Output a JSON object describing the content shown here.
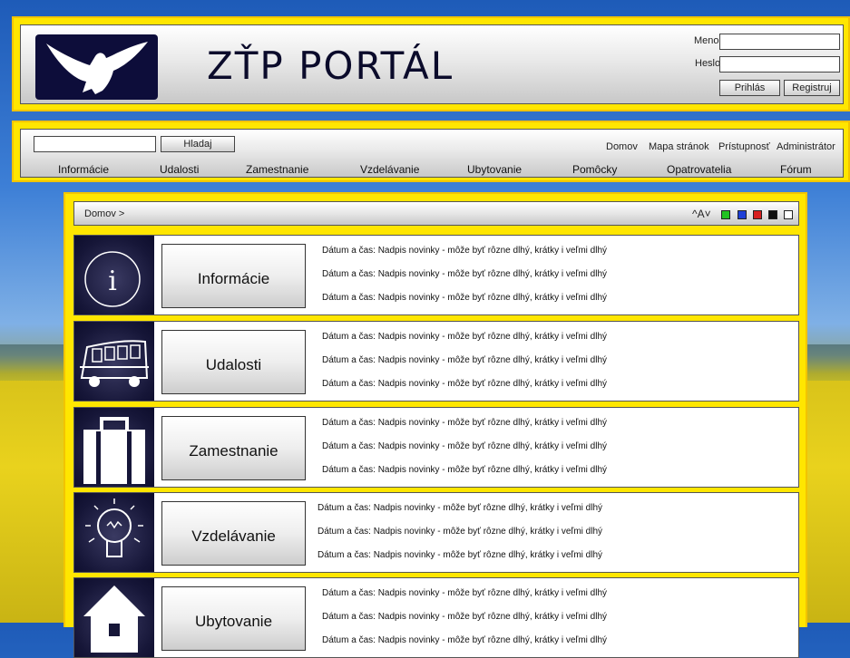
{
  "header": {
    "title": "ZŤP PORTÁL",
    "meno_label": "Meno:",
    "heslo_label": "Heslo:",
    "prihlas_label": "Prihlás",
    "registruj_label": "Registruj"
  },
  "nav": {
    "search_button": "Hladaj",
    "top_links": [
      "Domov",
      "Mapa stránok",
      "Prístupnosť",
      "Administrátor"
    ],
    "menu": [
      "Informácie",
      "Udalosti",
      "Zamestnanie",
      "Vzdelávanie",
      "Ubytovanie",
      "Pomôcky",
      "Opatrovatelia",
      "Fórum"
    ]
  },
  "breadcrumb": "Domov >",
  "font_controls": "^A˅",
  "color_swatches": [
    "#22c322",
    "#1e3fd6",
    "#d61e1e",
    "#111111",
    "#ffffff"
  ],
  "sections": [
    {
      "title": "Informácie",
      "icon": "info-icon",
      "news": [
        "Dátum a čas: Nadpis novinky - môže byť rôzne dlhý, krátky i veľmi dlhý",
        "Dátum a čas: Nadpis novinky - môže byť rôzne dlhý, krátky i veľmi dlhý",
        "Dátum a čas: Nadpis novinky - môže byť rôzne dlhý, krátky i veľmi dlhý"
      ]
    },
    {
      "title": "Udalosti",
      "icon": "bus-icon",
      "news": [
        "Dátum a čas: Nadpis novinky - môže byť rôzne dlhý, krátky i veľmi dlhý",
        "Dátum a čas: Nadpis novinky - môže byť rôzne dlhý, krátky i veľmi dlhý",
        "Dátum a čas: Nadpis novinky - môže byť rôzne dlhý, krátky i veľmi dlhý"
      ]
    },
    {
      "title": "Zamestnanie",
      "icon": "briefcase-icon",
      "news": [
        "Dátum a čas: Nadpis novinky - môže byť rôzne dlhý, krátky i veľmi dlhý",
        "Dátum a čas: Nadpis novinky - môže byť rôzne dlhý, krátky i veľmi dlhý",
        "Dátum a čas: Nadpis novinky - môže byť rôzne dlhý, krátky i veľmi dlhý"
      ]
    },
    {
      "title": "Vzdelávanie",
      "icon": "lightbulb-icon",
      "news": [
        "Dátum a čas: Nadpis novinky - môže byť rôzne dlhý, krátky i veľmi dlhý",
        "Dátum a čas: Nadpis novinky - môže byť rôzne dlhý, krátky i veľmi dlhý",
        "Dátum a čas: Nadpis novinky - môže byť rôzne dlhý, krátky i veľmi dlhý"
      ]
    },
    {
      "title": "Ubytovanie",
      "icon": "house-icon",
      "news": [
        "Dátum a čas: Nadpis novinky - môže byť rôzne dlhý, krátky i veľmi dlhý",
        "Dátum a čas: Nadpis novinky - môže byť rôzne dlhý, krátky i veľmi dlhý",
        "Dátum a čas: Nadpis novinky - môže byť rôzne dlhý, krátky i veľmi dlhý"
      ]
    }
  ]
}
